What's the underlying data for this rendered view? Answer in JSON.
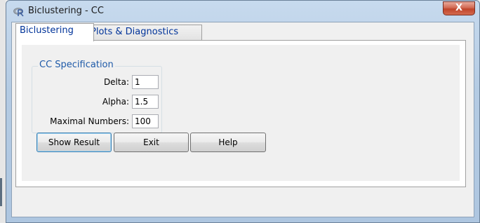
{
  "window": {
    "title": "Biclustering - CC",
    "close_label": "X"
  },
  "tabs": [
    {
      "label": "Biclustering",
      "active": true
    },
    {
      "label": "Plots & Diagnostics",
      "active": false
    }
  ],
  "cc_spec": {
    "legend": "CC Specification",
    "fields": [
      {
        "label": "Delta:",
        "value": "1"
      },
      {
        "label": "Alpha:",
        "value": "1.5"
      },
      {
        "label": "Maximal Numbers:",
        "value": "100"
      }
    ]
  },
  "buttons": {
    "show_result": "Show Result",
    "exit": "Exit",
    "help": "Help"
  },
  "colors": {
    "legend": "#1e5aa8",
    "tab_text": "#003399",
    "close": "#c0442a"
  },
  "icons": {
    "app": "r-logo-icon",
    "close": "close-icon"
  }
}
